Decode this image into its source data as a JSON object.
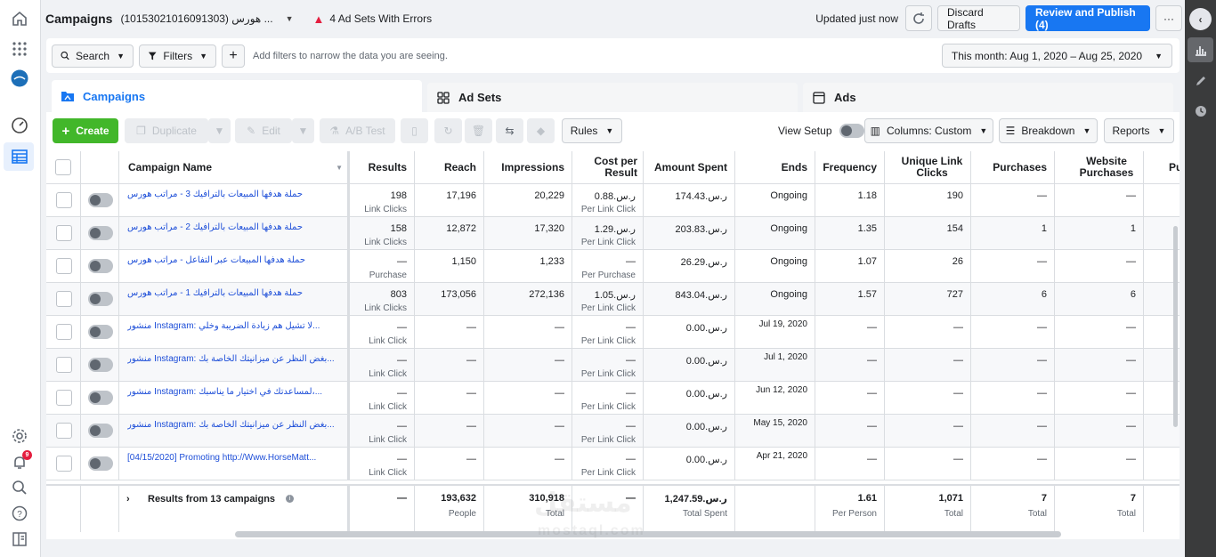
{
  "header": {
    "title": "Campaigns",
    "account": "(10153021016091303) هورس ...",
    "errors": "4 Ad Sets With Errors",
    "updated": "Updated just now",
    "discard": "Discard Drafts",
    "publish": "Review and Publish (4)",
    "more": "···"
  },
  "filterbar": {
    "search": "Search",
    "filters": "Filters",
    "hint": "Add filters to narrow the data you are seeing.",
    "date": "This month: Aug 1, 2020 – Aug 25, 2020"
  },
  "tabs": [
    "Campaigns",
    "Ad Sets",
    "Ads"
  ],
  "toolbar": {
    "create": "Create",
    "duplicate": "Duplicate",
    "edit": "Edit",
    "abtest": "A/B Test",
    "rules": "Rules",
    "view_setup": "View Setup",
    "columns": "Columns: Custom",
    "breakdown": "Breakdown",
    "reports": "Reports"
  },
  "notifications": {
    "count": "9"
  },
  "columns": [
    "Campaign Name",
    "Results",
    "Reach",
    "Impressions",
    "Cost per Result",
    "Amount Spent",
    "Ends",
    "Frequency",
    "Unique Link Clicks",
    "Purchases",
    "Website Purchases",
    "Pu"
  ],
  "rows": [
    {
      "name": "حملة هدفها المبيعات بالترافيك 3 - مراتب هورس",
      "results": "198",
      "results_sub": "Link Clicks",
      "reach": "17,196",
      "impr": "20,229",
      "cpr": "ر.س.0.88",
      "cpr_sub": "Per Link Click",
      "spent": "ر.س.174.43",
      "ends": "Ongoing",
      "freq": "1.18",
      "ulc": "190",
      "purch": "—",
      "wpurch": "—"
    },
    {
      "name": "حملة هدفها المبيعات بالترافيك 2 - مراتب هورس",
      "results": "158",
      "results_sub": "Link Clicks",
      "reach": "12,872",
      "impr": "17,320",
      "cpr": "ر.س.1.29",
      "cpr_sub": "Per Link Click",
      "spent": "ر.س.203.83",
      "ends": "Ongoing",
      "freq": "1.35",
      "ulc": "154",
      "purch": "1",
      "wpurch": "1"
    },
    {
      "name": "حملة هدفها المبيعات عبر التفاعل - مراتب هورس",
      "results": "—",
      "results_sub": "Purchase",
      "reach": "1,150",
      "impr": "1,233",
      "cpr": "—",
      "cpr_sub": "Per Purchase",
      "spent": "ر.س.26.29",
      "ends": "Ongoing",
      "freq": "1.07",
      "ulc": "26",
      "purch": "—",
      "wpurch": "—"
    },
    {
      "name": "حملة هدفها المبيعات بالترافيك 1 - مراتب هورس",
      "results": "803",
      "results_sub": "Link Clicks",
      "reach": "173,056",
      "impr": "272,136",
      "cpr": "ر.س.1.05",
      "cpr_sub": "Per Link Click",
      "spent": "ر.س.843.04",
      "ends": "Ongoing",
      "freq": "1.57",
      "ulc": "727",
      "purch": "6",
      "wpurch": "6"
    },
    {
      "name": "منشور Instagram: لا تشيل هم زيادة الضريبة وخلي...",
      "results": "—",
      "results_sub": "Link Click",
      "reach": "—",
      "impr": "—",
      "cpr": "—",
      "cpr_sub": "Per Link Click",
      "spent": "ر.س.0.00",
      "ends": "Jul 19, 2020",
      "freq": "—",
      "ulc": "—",
      "purch": "—",
      "wpurch": "—"
    },
    {
      "name": "منشور Instagram: بغض النظر عن ميزانيتك الخاصة بك...",
      "results": "—",
      "results_sub": "Link Click",
      "reach": "—",
      "impr": "—",
      "cpr": "—",
      "cpr_sub": "Per Link Click",
      "spent": "ر.س.0.00",
      "ends": "Jul 1, 2020",
      "freq": "—",
      "ulc": "—",
      "purch": "—",
      "wpurch": "—"
    },
    {
      "name": "منشور Instagram: لمساعدتك في اختيار ما يناسبك،...",
      "results": "—",
      "results_sub": "Link Click",
      "reach": "—",
      "impr": "—",
      "cpr": "—",
      "cpr_sub": "Per Link Click",
      "spent": "ر.س.0.00",
      "ends": "Jun 12, 2020",
      "freq": "—",
      "ulc": "—",
      "purch": "—",
      "wpurch": "—"
    },
    {
      "name": "منشور Instagram: بغض النظر عن ميزانيتك الخاصة بك...",
      "results": "—",
      "results_sub": "Link Click",
      "reach": "—",
      "impr": "—",
      "cpr": "—",
      "cpr_sub": "Per Link Click",
      "spent": "ر.س.0.00",
      "ends": "May 15, 2020",
      "freq": "—",
      "ulc": "—",
      "purch": "—",
      "wpurch": "—"
    },
    {
      "name": "[04/15/2020] Promoting http://Www.HorseMatt...",
      "results": "—",
      "results_sub": "Link Click",
      "reach": "—",
      "impr": "—",
      "cpr": "—",
      "cpr_sub": "Per Link Click",
      "spent": "ر.س.0.00",
      "ends": "Apr 21, 2020",
      "freq": "—",
      "ulc": "—",
      "purch": "—",
      "wpurch": "—"
    }
  ],
  "totals": {
    "label": "Results from 13 campaigns",
    "results": "—",
    "reach": "193,632",
    "reach_sub": "People",
    "impr": "310,918",
    "impr_sub": "Total",
    "cpr": "—",
    "spent": "ر.س.1,247.59",
    "spent_sub": "Total Spent",
    "freq": "1.61",
    "freq_sub": "Per Person",
    "ulc": "1,071",
    "ulc_sub": "Total",
    "purch": "7",
    "purch_sub": "Total",
    "wpurch": "7",
    "wpurch_sub": "Total"
  },
  "watermark": {
    "ar": "مستقل",
    "en": "mostaql.com"
  },
  "colors": {
    "accent": "#1877f2",
    "create": "#42b72a",
    "error": "#e41e3f"
  }
}
